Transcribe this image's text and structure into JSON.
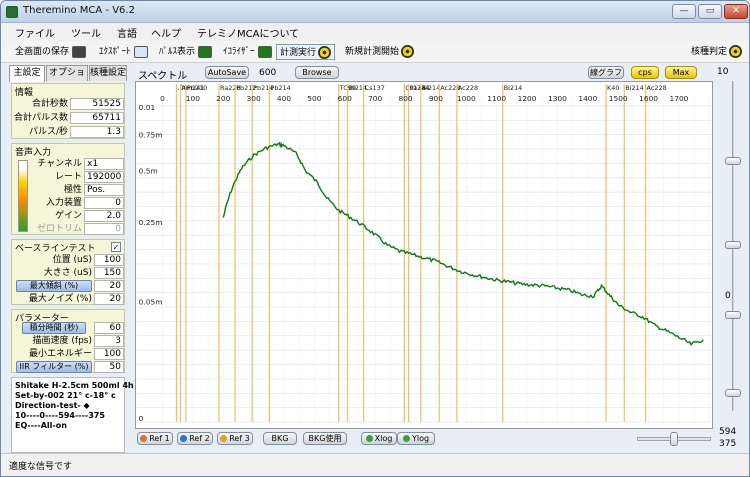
{
  "window": {
    "title": "Theremino MCA - V6.2",
    "minimize": "—",
    "maximize": "▭",
    "close": "✕"
  },
  "menu": [
    "ファイル",
    "ツール",
    "言語",
    "ヘルプ",
    "テレミノMCAについて"
  ],
  "toolbar": {
    "save_all": "全画面の保存",
    "export": "ｴｸｽﾎﾟｰﾄ",
    "pulse_display": "ﾊﾟﾙｽ表示",
    "equalizer": "ｲｺﾗｲｻﾞｰ",
    "run": "計測実行",
    "new_measure": "新規計測開始",
    "nuclide_id": "核種判定"
  },
  "tabs": [
    "主設定",
    "オプション",
    "核種設定"
  ],
  "info": {
    "title": "情報",
    "rows": [
      {
        "label": "合計秒数",
        "value": "51525"
      },
      {
        "label": "合計パルス数",
        "value": "65711"
      },
      {
        "label": "パルス/秒",
        "value": "1.3"
      }
    ]
  },
  "audio": {
    "title": "音声入力",
    "rows": [
      {
        "label": "チャンネル",
        "value": "x1"
      },
      {
        "label": "レート",
        "value": "192000"
      },
      {
        "label": "極性",
        "value": "Pos."
      },
      {
        "label": "入力装置",
        "value": "0"
      },
      {
        "label": "ゲイン",
        "value": "2.0"
      },
      {
        "label": "ゼロトリム",
        "value": "0"
      }
    ]
  },
  "baseline": {
    "title": "ベースラインテスト",
    "checked": "✓",
    "rows": [
      {
        "label": "位置 (uS)",
        "value": "100"
      },
      {
        "label": "大きさ (uS)",
        "value": "150"
      },
      {
        "label": "最大傾斜 (%)",
        "value": "20"
      },
      {
        "label": "最大ノイズ (%)",
        "value": "20"
      }
    ]
  },
  "params": {
    "title": "パラメーター",
    "rows": [
      {
        "label": "積分時間 (秒)",
        "value": "60"
      },
      {
        "label": "描画速度 (fps)",
        "value": "3"
      },
      {
        "label": "最小エネルギー",
        "value": "100"
      },
      {
        "label": "IIR フィルター (%)",
        "value": "50"
      }
    ]
  },
  "memo": [
    "Shitake  H-2.5cm 500ml  4h",
    "Set-by-002  21° c-18° c",
    "",
    "Direction-test- ◆",
    "10----0----594----375",
    "EQ----All-on"
  ],
  "spectrum": {
    "label": "スペクトル",
    "autosave": "AutoSave",
    "autosave_value": "600",
    "browse": "Browse",
    "line_graph": "線グラフ",
    "cps": "cps",
    "max": "Max"
  },
  "chart_data": {
    "type": "line",
    "title": "",
    "xlabel": "",
    "ylabel": "",
    "x_ticks": [
      "0",
      "100",
      "200",
      "300",
      "400",
      "500",
      "600",
      "700",
      "800",
      "900",
      "1000",
      "1100",
      "1200",
      "1300",
      "1400",
      "1500",
      "1600",
      "1700"
    ],
    "y_ticks": [
      "0.01",
      "0.75m",
      "0.5m",
      "0.25m",
      "0.05m",
      "0"
    ],
    "xlim": [
      0,
      1800
    ],
    "scale": "log",
    "grid": true,
    "nuclides": [
      {
        "name": ".00",
        "energy": 46
      },
      {
        "name": "Am241",
        "energy": 59
      },
      {
        "name": "Pb210",
        "energy": 77
      },
      {
        "name": "Ra226",
        "energy": 186
      },
      {
        "name": "Pb212",
        "energy": 239
      },
      {
        "name": "Pb214",
        "energy": 295
      },
      {
        "name": "Pb214",
        "energy": 352
      },
      {
        "name": "TC99",
        "energy": 580
      },
      {
        "name": "Bi214",
        "energy": 609
      },
      {
        "name": "Cs137",
        "energy": 662
      },
      {
        "name": "Cs134",
        "energy": 796
      },
      {
        "name": "Pa234",
        "energy": 810
      },
      {
        "name": "Bi214",
        "energy": 850
      },
      {
        "name": "Ac228",
        "energy": 911
      },
      {
        "name": "Ac228",
        "energy": 969
      },
      {
        "name": "Bi214",
        "energy": 1120
      },
      {
        "name": "K40",
        "energy": 1460
      },
      {
        "name": "Bi214",
        "energy": 1520
      },
      {
        "name": "Ac228",
        "energy": 1590
      }
    ],
    "series": [
      {
        "x": [
          200,
          230,
          260,
          300,
          340,
          380,
          400,
          440,
          470,
          510,
          540,
          580,
          620,
          660,
          700,
          740,
          780,
          820,
          860,
          900,
          940,
          980,
          1020,
          1060,
          1100,
          1140,
          1180,
          1220,
          1260,
          1300,
          1340,
          1380,
          1420,
          1445,
          1470,
          1500,
          1540,
          1580,
          1620,
          1660,
          1700,
          1740,
          1780
        ],
        "y": [
          0.18,
          0.28,
          0.37,
          0.45,
          0.5,
          0.53,
          0.52,
          0.46,
          0.36,
          0.3,
          0.24,
          0.2,
          0.18,
          0.16,
          0.14,
          0.12,
          0.11,
          0.105,
          0.1,
          0.095,
          0.088,
          0.082,
          0.078,
          0.075,
          0.072,
          0.07,
          0.068,
          0.067,
          0.066,
          0.064,
          0.062,
          0.058,
          0.057,
          0.066,
          0.058,
          0.05,
          0.045,
          0.042,
          0.037,
          0.034,
          0.031,
          0.028,
          0.03
        ]
      }
    ]
  },
  "bottom": {
    "ref1": "Ref 1",
    "ref2": "Ref 2",
    "ref3": "Ref 3",
    "bkg": "BKG",
    "bkg_use": "BKG使用",
    "xlog": "Xlog",
    "ylog": "Ylog"
  },
  "right": {
    "top": "10",
    "mid": "0",
    "v1": "594",
    "v2": "375"
  },
  "status": "適度な信号です"
}
